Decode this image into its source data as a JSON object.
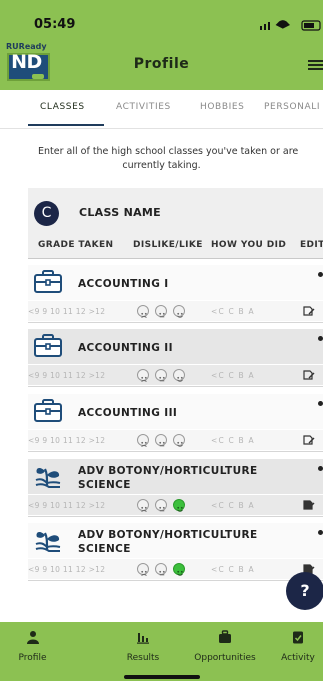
{
  "status_bar": {
    "time": "05:49"
  },
  "header": {
    "logo_small": "RUReady",
    "logo_main": "ND",
    "title": "Profile",
    "colors": {
      "bar": "#8cc152",
      "logo": "#1f4d7a"
    }
  },
  "tabs": [
    {
      "label": "CLASSES",
      "active": true
    },
    {
      "label": "ACTIVITIES",
      "active": false
    },
    {
      "label": "HOBBIES",
      "active": false
    },
    {
      "label": "PERSONALI",
      "active": false
    }
  ],
  "intro": {
    "line1": "Enter all of the high school classes you've taken or are",
    "line2": "currently taking."
  },
  "table": {
    "avatar_letter": "C",
    "name_header": "CLASS NAME",
    "columns": [
      "GRADE TAKEN",
      "DISLIKE/LIKE",
      "HOW YOU DID",
      "EDIT"
    ],
    "grade_scale": "<9 9 10 11 12 >12",
    "mark_scale": "<C C B A"
  },
  "courses": [
    {
      "name_line1": "ACCOUNTING I",
      "name_line2": "",
      "icon": "briefcase-icon",
      "like": "none"
    },
    {
      "name_line1": "ACCOUNTING II",
      "name_line2": "",
      "icon": "briefcase-icon",
      "like": "none"
    },
    {
      "name_line1": "ACCOUNTING III",
      "name_line2": "",
      "icon": "briefcase-icon",
      "like": "none"
    },
    {
      "name_line1": "ADV BOTONY/HORTICULTURE",
      "name_line2": "SCIENCE",
      "icon": "seedling-icon",
      "like": "happy"
    },
    {
      "name_line1": "ADV BOTONY/HORTICULTURE",
      "name_line2": "SCIENCE",
      "icon": "seedling-icon",
      "like": "happy"
    }
  ],
  "help": {
    "label": "?"
  },
  "nav": [
    {
      "label": "Profile",
      "icon": "person-icon",
      "active": true
    },
    {
      "label": "Results",
      "icon": "bar-chart-icon",
      "active": false
    },
    {
      "label": "Opportunities",
      "icon": "briefcase-icon",
      "active": false
    },
    {
      "label": "Activity",
      "icon": "clipboard-check-icon",
      "active": false
    }
  ]
}
